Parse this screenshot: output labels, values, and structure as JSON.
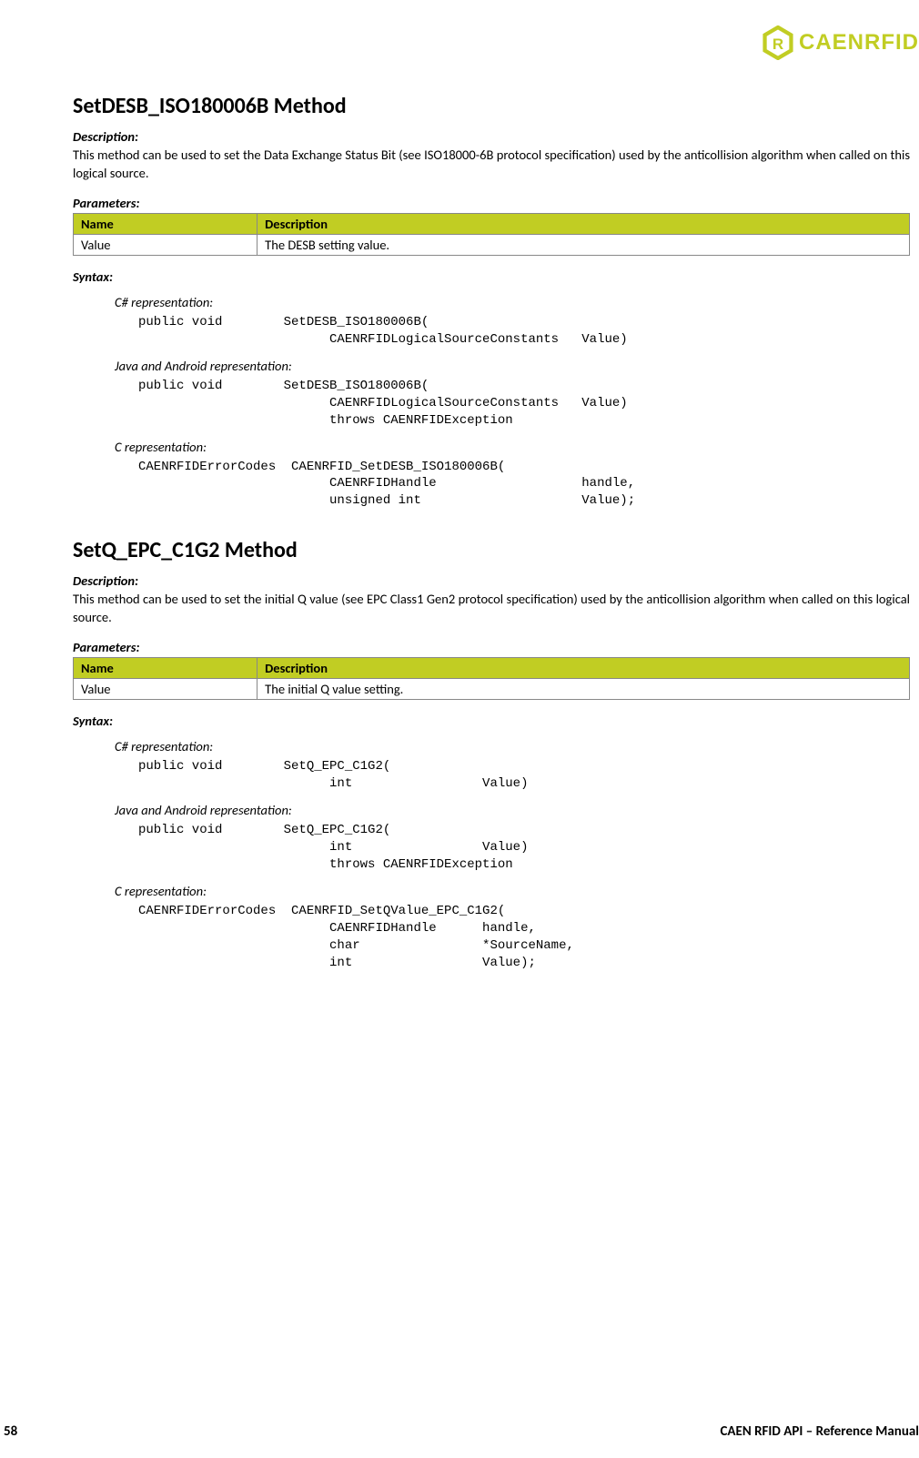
{
  "brand": {
    "name": "CAENRFID"
  },
  "footer": {
    "page": "58",
    "manual": "CAEN RFID API – Reference Manual"
  },
  "methods": [
    {
      "title": "SetDESB_ISO180006B Method",
      "descLabel": "Description:",
      "desc": "This method can be used to set the Data Exchange Status Bit (see ISO18000-6B protocol specification) used by the anticollision algorithm when called on this logical source.",
      "paramLabel": "Parameters:",
      "paramHeaders": {
        "name": "Name",
        "desc": "Description"
      },
      "paramRows": [
        {
          "name": "Value",
          "desc": "The DESB setting value."
        }
      ],
      "syntaxLabel": "Syntax:",
      "reps": [
        {
          "label": "C# representation:",
          "code": "public void        SetDESB_ISO180006B(\n                         CAENRFIDLogicalSourceConstants   Value)"
        },
        {
          "label": "Java and Android representation:",
          "code": "public void        SetDESB_ISO180006B(\n                         CAENRFIDLogicalSourceConstants   Value)\n                         throws CAENRFIDException"
        },
        {
          "label": "C representation:",
          "code": "CAENRFIDErrorCodes  CAENRFID_SetDESB_ISO180006B(\n                         CAENRFIDHandle                   handle,\n                         unsigned int                     Value);"
        }
      ]
    },
    {
      "title": "SetQ_EPC_C1G2 Method",
      "descLabel": "Description:",
      "desc": "This method can be used to set the initial Q value (see EPC Class1 Gen2 protocol specification) used by the anticollision algorithm when called on this logical source.",
      "paramLabel": "Parameters:",
      "paramHeaders": {
        "name": "Name",
        "desc": "Description"
      },
      "paramRows": [
        {
          "name": "Value",
          "desc": "The initial Q value setting."
        }
      ],
      "syntaxLabel": "Syntax:",
      "reps": [
        {
          "label": "C# representation:",
          "code": "public void        SetQ_EPC_C1G2(\n                         int                 Value)"
        },
        {
          "label": "Java and Android representation:",
          "code": "public void        SetQ_EPC_C1G2(\n                         int                 Value)\n                         throws CAENRFIDException"
        },
        {
          "label": "C representation:",
          "code": "CAENRFIDErrorCodes  CAENRFID_SetQValue_EPC_C1G2(\n                         CAENRFIDHandle      handle,\n                         char                *SourceName,\n                         int                 Value);"
        }
      ]
    }
  ]
}
